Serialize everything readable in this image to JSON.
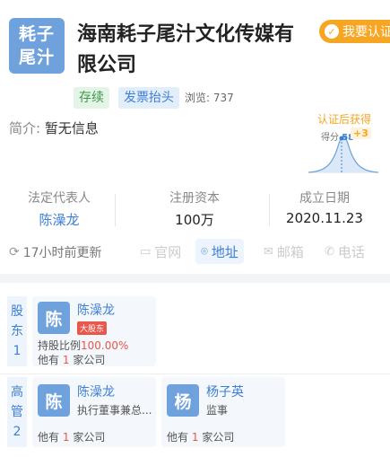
{
  "company": {
    "logo_line1": "耗子",
    "logo_line2": "尾汁",
    "name": "海南耗子尾汁文化传媒有限公司",
    "verify_button": "我要认证",
    "status_tag": "存续",
    "invoice_tag": "发票抬头",
    "views_label": "浏览: 737",
    "intro_label": "简介:",
    "intro_value": "暂无信息"
  },
  "score": {
    "title": "认证后获得",
    "label": "得分",
    "value": "58",
    "bonus": "+3"
  },
  "facts": [
    {
      "key": "法定代表人",
      "value": "陈澡龙"
    },
    {
      "key": "注册资本",
      "value": "100万"
    },
    {
      "key": "成立日期",
      "value": "2020.11.23"
    }
  ],
  "actions": {
    "updated": "17小时前更新",
    "website": "官网",
    "address": "地址",
    "email": "邮箱",
    "phone": "电话"
  },
  "shareholders": {
    "side_label": [
      "股",
      "东",
      "1"
    ],
    "items": [
      {
        "avatar": "陈",
        "name": "陈澡龙",
        "badge": "大股东",
        "ratio_label": "持股比例",
        "ratio_value": "100.00%",
        "other_prefix": "他有",
        "other_count": "1",
        "other_suffix": "家公司"
      }
    ]
  },
  "executives": {
    "side_label": [
      "高",
      "管",
      "2"
    ],
    "items": [
      {
        "avatar": "陈",
        "name": "陈澡龙",
        "role": "执行董事兼总...",
        "other_prefix": "他有",
        "other_count": "1",
        "other_suffix": "家公司"
      },
      {
        "avatar": "杨",
        "name": "杨子英",
        "role": "监事",
        "other_prefix": "他有",
        "other_count": "1",
        "other_suffix": "家公司"
      }
    ]
  }
}
